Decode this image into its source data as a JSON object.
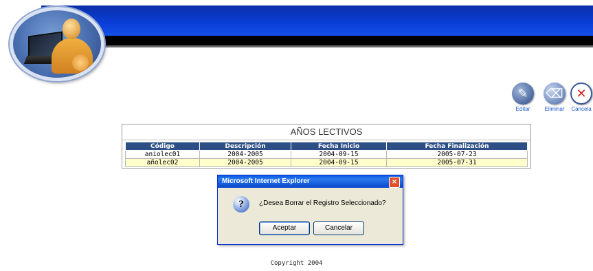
{
  "toolbar": {
    "edit_label": "Editar",
    "delete_label": "Eliminar",
    "cancel_label": "Cancela"
  },
  "table": {
    "title": "AÑOS LECTIVOS",
    "columns": [
      "Código",
      "Descripción",
      "Fecha Inicio",
      "Fecha Finalización"
    ],
    "rows": [
      [
        "aniolec01",
        "2004-2005",
        "2004-09-15",
        "2005-07-23"
      ],
      [
        "añolec02",
        "2004-2005",
        "2004-09-15",
        "2005-07-31"
      ]
    ]
  },
  "dialog": {
    "title": "Microsoft Internet Explorer",
    "message": "¿Desea Borrar el Registro Seleccionado?",
    "ok_label": "Aceptar",
    "cancel_label": "Cancelar",
    "close_glyph": "×",
    "question_glyph": "?"
  },
  "footer": {
    "copyright": "Copyright 2004"
  },
  "colors": {
    "banner_blue": "#0a3fd8",
    "table_header": "#2e4f86",
    "row_highlight": "#ffffcc"
  }
}
